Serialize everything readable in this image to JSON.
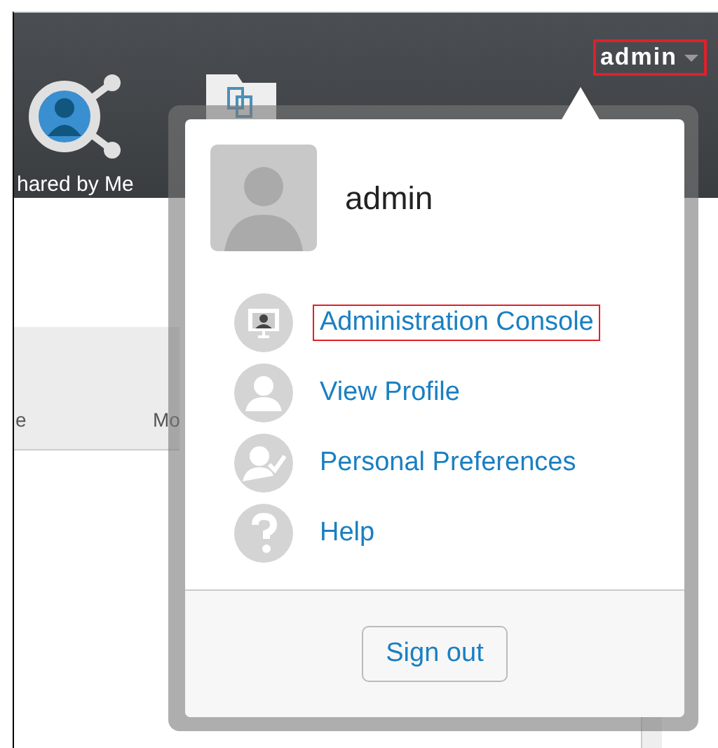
{
  "header": {
    "nav_items": [
      {
        "label": "hared by Me",
        "kind": "shared"
      },
      {
        "kind": "folder"
      }
    ],
    "user_menu": {
      "label": "admin",
      "highlighted": true
    }
  },
  "content": {
    "column_1": "e",
    "column_2": "Mo"
  },
  "dropdown": {
    "user_name": "admin",
    "items": [
      {
        "label": "Administration Console",
        "kind": "console",
        "highlighted": true
      },
      {
        "label": "View Profile",
        "kind": "profile",
        "highlighted": false
      },
      {
        "label": "Personal Preferences",
        "kind": "preferences",
        "highlighted": false
      },
      {
        "label": "Help",
        "kind": "help",
        "highlighted": false
      }
    ],
    "sign_out": "Sign out"
  }
}
